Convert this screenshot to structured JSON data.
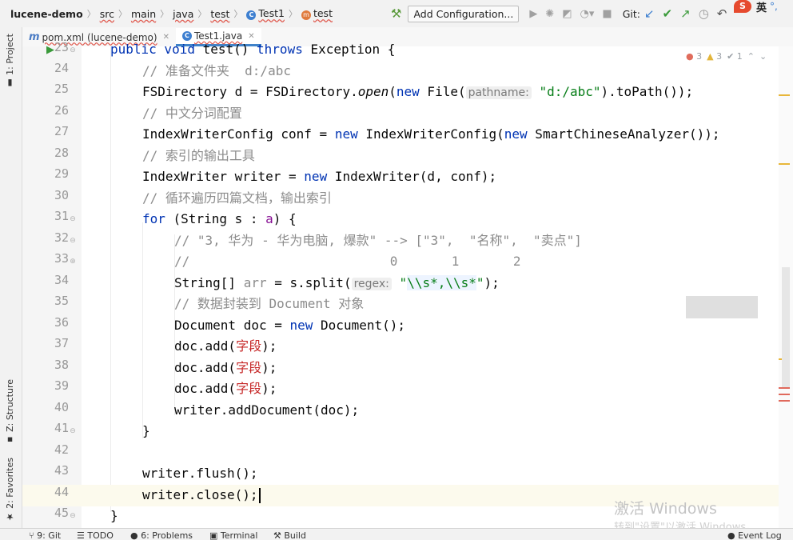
{
  "nav": {
    "project": "lucene-demo",
    "crumbs": [
      "src",
      "main",
      "java",
      "test"
    ],
    "class_crumb": "Test1",
    "method_crumb": "test",
    "add_config": "Add Configuration...",
    "git_label": "Git:"
  },
  "tabs": [
    {
      "label": "pom.xml (lucene-demo)",
      "icon": "maven-icon"
    },
    {
      "label": "Test1.java",
      "icon": "java-class-icon",
      "active": true
    }
  ],
  "side_tabs": {
    "project": "1: Project",
    "structure": "Z: Structure",
    "favorites": "2: Favorites"
  },
  "inspections": {
    "errors": "3",
    "warnings": "3",
    "weak": "1"
  },
  "editor": {
    "current_line": 44,
    "lines": {
      "23": {
        "n": "23",
        "kw1": "public void",
        "rest": " test() ",
        "kw2": "throws",
        "tail": " Exception {"
      },
      "24": {
        "n": "24",
        "comment": "// 准备文件夹  d:/abc"
      },
      "25": {
        "n": "25",
        "a": "FSDirectory d = FSDirectory.",
        "m": "open",
        "b": "(",
        "kw": "new",
        "c": " File(",
        "hint": "pathname:",
        "str": "\"d:/abc\"",
        "d": ").toPath());"
      },
      "26": {
        "n": "26",
        "comment": "// 中文分词配置"
      },
      "27": {
        "n": "27",
        "a": "IndexWriterConfig conf = ",
        "kw1": "new",
        "b": " IndexWriterConfig(",
        "kw2": "new",
        "c": " SmartChineseAnalyzer());"
      },
      "28": {
        "n": "28",
        "comment": "// 索引的输出工具"
      },
      "29": {
        "n": "29",
        "a": "IndexWriter writer = ",
        "kw": "new",
        "b": " IndexWriter(d, conf);"
      },
      "30": {
        "n": "30",
        "comment": "// 循环遍历四篇文档，输出索引"
      },
      "31": {
        "n": "31",
        "kw": "for",
        "a": " (String s : ",
        "v": "a",
        "b": ") {"
      },
      "32": {
        "n": "32",
        "comment": "// \"3, 华为 - 华为电脑, 爆款\" --> [\"3\",  \"名称\",  \"卖点\"]"
      },
      "33": {
        "n": "33",
        "comment": "//                          0       1       2"
      },
      "34": {
        "n": "34",
        "a": "String[] ",
        "v": "arr",
        "b": " = s.split(",
        "hint": "regex:",
        "str1": "\"",
        "rx": "\\\\s*,\\\\s*",
        "str2": "\"",
        "c": ");"
      },
      "35": {
        "n": "35",
        "comment": "// 数据封装到 Document 对象"
      },
      "36": {
        "n": "36",
        "a": "Document doc = ",
        "kw": "new",
        "b": " Document();"
      },
      "37": {
        "n": "37",
        "a": "doc.add(",
        "err": "字段",
        "b": ");"
      },
      "38": {
        "n": "38",
        "a": "doc.add(",
        "err": "字段",
        "b": ");"
      },
      "39": {
        "n": "39",
        "a": "doc.add(",
        "err": "字段",
        "b": ");"
      },
      "40": {
        "n": "40",
        "a": "writer.addDocument(doc);"
      },
      "41": {
        "n": "41",
        "a": "}"
      },
      "42": {
        "n": "42"
      },
      "43": {
        "n": "43",
        "a": "writer.flush();"
      },
      "44": {
        "n": "44",
        "a": "writer.close();"
      },
      "45": {
        "n": "45",
        "a": "}"
      }
    }
  },
  "watermark": {
    "line1": "激活 Windows",
    "line2": "转到\"设置\"以激活 Windows。"
  },
  "ime": {
    "logo": "S",
    "label": "英"
  },
  "status_bar": [
    "9: Git",
    "TODO",
    "6: Problems",
    "Terminal",
    "Build",
    "Event Log"
  ],
  "colors": {
    "keyword": "#0033b3",
    "comment": "#8c8c8c",
    "string": "#067d17",
    "error": "#c62828",
    "accent": "#4083c9"
  }
}
